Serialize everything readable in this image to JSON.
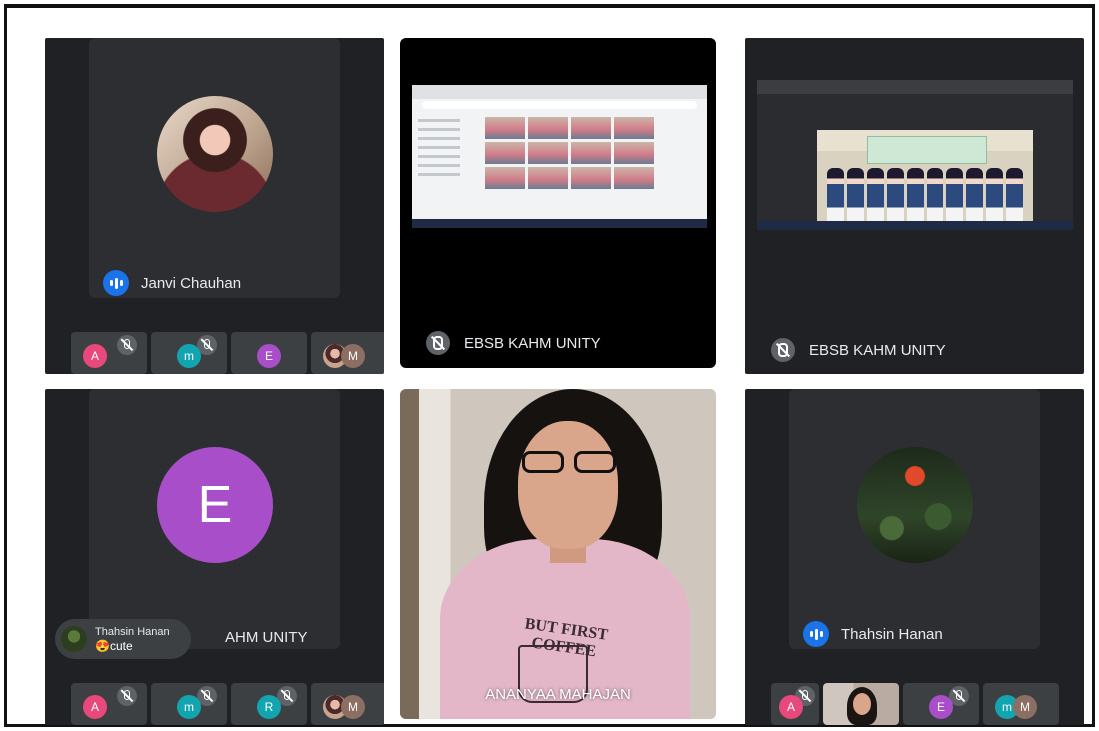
{
  "tiles": {
    "janvi": {
      "name": "Janvi Chauhan"
    },
    "screen1": {
      "name": "EBSB KAHM UNITY"
    },
    "screen2": {
      "name": "EBSB KAHM UNITY"
    },
    "e_tile": {
      "initial": "E",
      "name_partial": "AHM UNITY"
    },
    "ananyaa": {
      "name": "ANANYAA MAHAJAN",
      "shirt_text": "BUT FIRST COFFEE"
    },
    "thahsin": {
      "name": "Thahsin Hanan"
    }
  },
  "chat": {
    "sender": "Thahsin Hanan",
    "message": "😍cute"
  },
  "strip_top_left": {
    "a": "A",
    "m": "m",
    "e": "E",
    "m2": "M"
  },
  "strip_bottom_left": {
    "a": "A",
    "m": "m",
    "r": "R",
    "m2": "M"
  },
  "strip_bottom_right": {
    "a": "A",
    "e": "E",
    "m": "m",
    "m2": "M"
  },
  "colors": {
    "meet_dark": "#202124",
    "speaking_blue": "#1a73e8",
    "avatar_purple": "#a84ec8",
    "avatar_pink": "#e8487b",
    "avatar_teal": "#12a4af"
  }
}
